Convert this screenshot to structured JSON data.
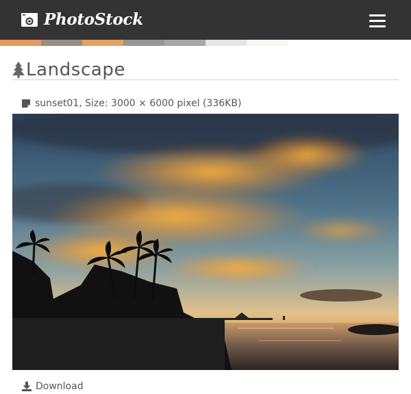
{
  "header": {
    "logo_text": "PhotoStock",
    "background": "#333333",
    "logo_icon": "camera-icon",
    "menu_icon": "hamburger-menu-icon"
  },
  "color_strip": [
    "#e59a5c",
    "#979082",
    "#e5a062",
    "#979694",
    "#a7a7a7",
    "#e4e4e4",
    "#f7f7f2"
  ],
  "page": {
    "title_icon": "tree-icon",
    "title": "Landscape"
  },
  "file": {
    "icon": "file-icon",
    "info": "sunset01, Size: 3000 × 6000 pixel (336KB)"
  },
  "photo": {
    "subject": "sunset-photo"
  },
  "download": {
    "icon": "download-icon",
    "label": "Download"
  }
}
